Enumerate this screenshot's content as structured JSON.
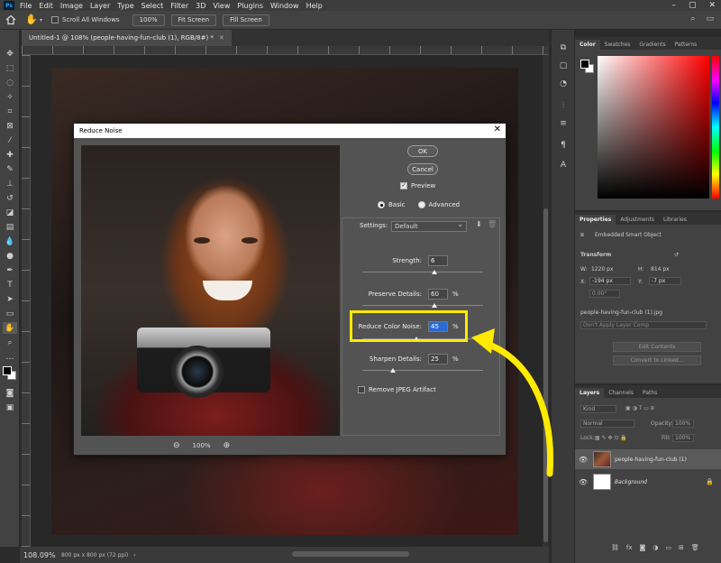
{
  "menubar": {
    "items": [
      "File",
      "Edit",
      "Image",
      "Layer",
      "Type",
      "Select",
      "Filter",
      "3D",
      "View",
      "Plugins",
      "Window",
      "Help"
    ]
  },
  "options": {
    "scroll_all": "Scroll All Windows",
    "zoom_btn": "100%",
    "fit_btn": "Fit Screen",
    "fill_btn": "Fill Screen"
  },
  "document": {
    "tab_title": "Untitled-1 @ 108% (people-having-fun-club (1), RGB/8#) *"
  },
  "status": {
    "zoom": "108.09%",
    "info": "800 px x 800 px (72 ppi)"
  },
  "color_panel": {
    "tabs": [
      "Color",
      "Swatches",
      "Gradients",
      "Patterns"
    ]
  },
  "properties": {
    "tabs": [
      "Properties",
      "Adjustments",
      "Libraries"
    ],
    "object_type": "Embedded Smart Object",
    "section": "Transform",
    "w_label": "W:",
    "w_value": "1220 px",
    "h_label": "H:",
    "h_value": "814 px",
    "x_label": "X:",
    "x_value": "-194 px",
    "y_label": "Y:",
    "y_value": "-7 px",
    "angle": "0.00°",
    "source_file": "people-having-fun-club (1).jpg",
    "layer_comp": "Don't Apply Layer Comp",
    "edit_contents": "Edit Contents",
    "convert_linked": "Convert to Linked..."
  },
  "layers": {
    "tabs": [
      "Layers",
      "Channels",
      "Paths"
    ],
    "kind": "Kind",
    "blend_mode": "Normal",
    "opacity_label": "Opacity:",
    "opacity_value": "100%",
    "lock_label": "Lock:",
    "fill_label": "Fill:",
    "fill_value": "100%",
    "items": [
      {
        "name": "people-having-fun-club (1)"
      },
      {
        "name": "Background"
      }
    ]
  },
  "dialog": {
    "title": "Reduce Noise",
    "ok": "OK",
    "cancel": "Cancel",
    "preview_label": "Preview",
    "preview_checked": true,
    "mode_basic": "Basic",
    "mode_advanced": "Advanced",
    "mode_selected": "Basic",
    "settings_label": "Settings:",
    "settings_value": "Default",
    "zoom_level": "100%",
    "params": [
      {
        "label": "Strength:",
        "value": "6",
        "unit": "",
        "fraction": 0.6
      },
      {
        "label": "Preserve Details:",
        "value": "60",
        "unit": "%",
        "fraction": 0.6
      },
      {
        "label": "Reduce Color Noise:",
        "value": "45",
        "unit": "%",
        "fraction": 0.45
      },
      {
        "label": "Sharpen Details:",
        "value": "25",
        "unit": "%",
        "fraction": 0.25
      }
    ],
    "jpeg_label": "Remove JPEG Artifact"
  },
  "colors": {
    "highlight": "#ffea00",
    "accent": "#2a6bd3"
  }
}
